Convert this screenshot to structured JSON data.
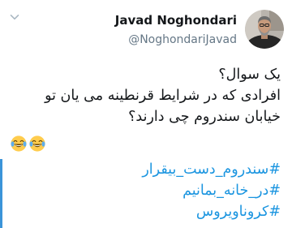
{
  "tweet": {
    "author": {
      "display_name": "Javad Noghondari",
      "handle": "@NoghondariJavad"
    },
    "body_lines": [
      "یک سوال؟",
      "افرادی که در شرایط قرنطینه می یان تو",
      "خیابان سندروم چی دارند؟"
    ],
    "emojis": [
      "😂",
      "😂"
    ],
    "hashtags": [
      "#سندروم_دست_بیقرار",
      "#در_خانه_بمانیم",
      "#کرونا‌ویروس"
    ]
  },
  "colors": {
    "text": "#14171a",
    "secondary_text": "#657786",
    "link": "#1b95e0",
    "accent_bar": "#3b94d9"
  },
  "icons": {
    "menu": "chevron-down-icon",
    "emoji": "face-with-tears-of-joy-icon",
    "avatar": "profile-photo"
  }
}
